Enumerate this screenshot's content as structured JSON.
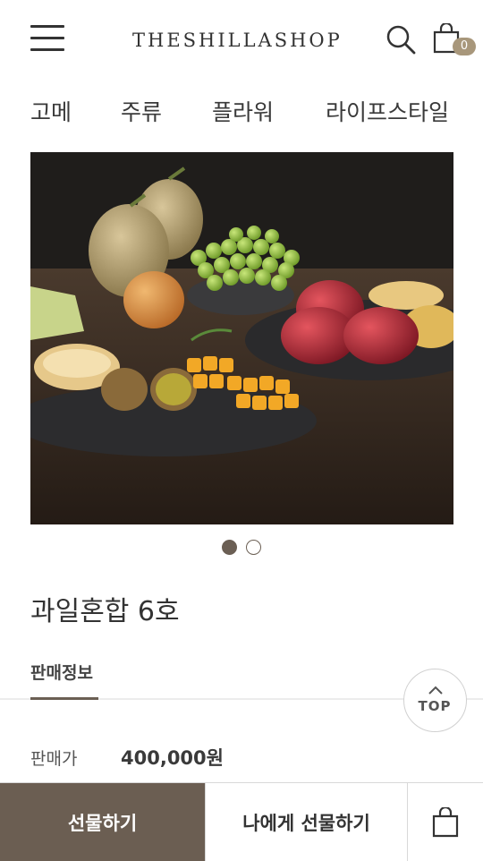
{
  "header": {
    "logo_text": "THESHILLASHOP",
    "cart_count": "0"
  },
  "categories": [
    "고메",
    "주류",
    "플라워",
    "라이프스타일"
  ],
  "carousel": {
    "slide_count": 2,
    "active_index": 0
  },
  "product": {
    "title": "과일혼합 6호"
  },
  "tabs": {
    "sales_info": "판매정보"
  },
  "top_button": {
    "label": "TOP"
  },
  "price": {
    "label": "판매가",
    "value": "400,000원"
  },
  "bottom_bar": {
    "gift_label": "선물하기",
    "self_gift_label": "나에게 선물하기"
  },
  "colors": {
    "accent_brown": "#6b5e52",
    "badge": "#a8977b"
  }
}
